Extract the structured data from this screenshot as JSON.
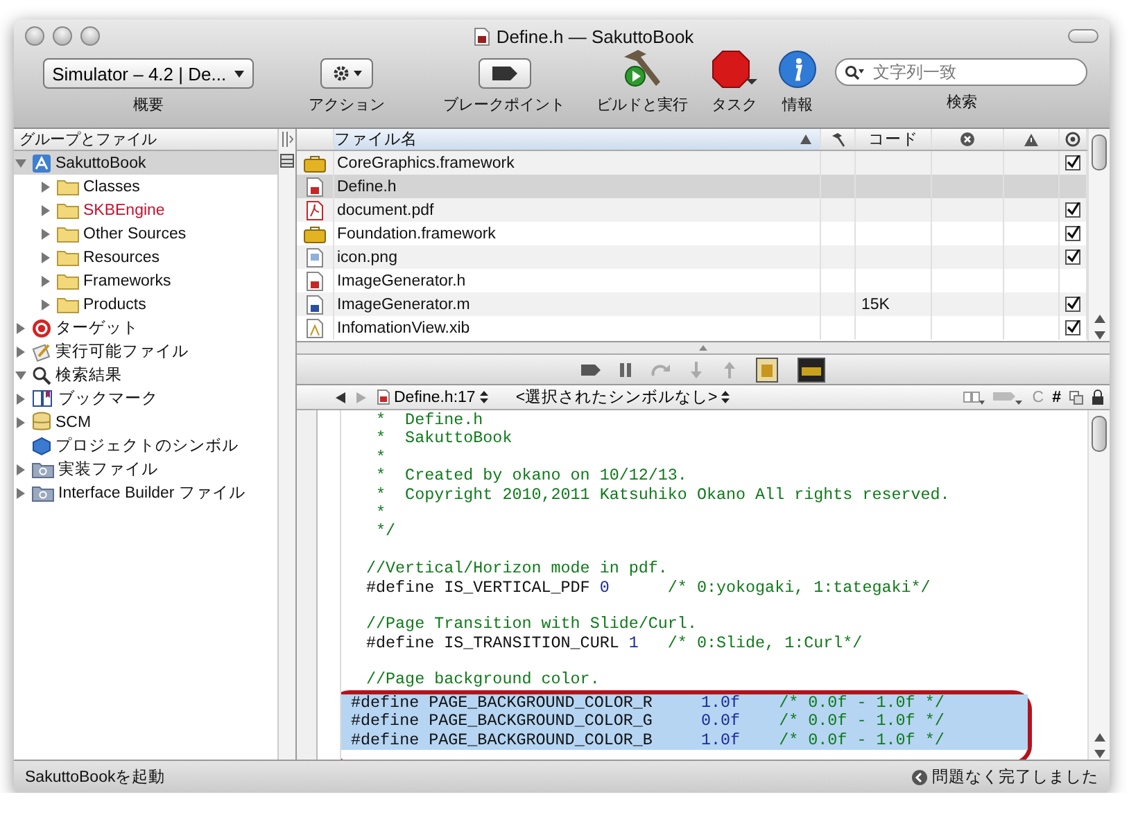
{
  "window": {
    "title": "Define.h — SakuttoBook"
  },
  "toolbar": {
    "scheme_popup": "Simulator – 4.2 | De...",
    "items": [
      {
        "kind": "scheme",
        "label": "概要"
      },
      {
        "kind": "action",
        "label": "アクション"
      },
      {
        "kind": "breakpoints",
        "label": "ブレークポイント"
      },
      {
        "kind": "build",
        "label": "ビルドと実行"
      },
      {
        "kind": "tasks",
        "label": "タスク"
      },
      {
        "kind": "info",
        "label": "情報"
      },
      {
        "kind": "search",
        "label": "検索"
      }
    ],
    "search": {
      "placeholder": "文字列一致"
    }
  },
  "sidebar": {
    "header": "グループとファイル",
    "items": [
      {
        "kind": "project",
        "label": "SakuttoBook",
        "expanded": true,
        "selected": true,
        "children": [
          {
            "kind": "folder",
            "label": "Classes",
            "expanded": false,
            "missing": false,
            "selected": false
          },
          {
            "kind": "folder",
            "label": "SKBEngine",
            "expanded": false,
            "missing": true,
            "selected": false
          },
          {
            "kind": "folder",
            "label": "Other Sources",
            "expanded": false,
            "missing": false,
            "selected": false
          },
          {
            "kind": "folder",
            "label": "Resources",
            "expanded": false,
            "missing": false,
            "selected": false
          },
          {
            "kind": "folder",
            "label": "Frameworks",
            "expanded": false,
            "missing": false,
            "selected": false
          },
          {
            "kind": "folder",
            "label": "Products",
            "expanded": false,
            "missing": false,
            "selected": false
          }
        ]
      },
      {
        "kind": "target",
        "label": "ターゲット",
        "expanded": false,
        "selected": false
      },
      {
        "kind": "executable",
        "label": "実行可能ファイル",
        "expanded": false,
        "selected": false
      },
      {
        "kind": "search",
        "label": "検索結果",
        "expanded": true,
        "selected": false
      },
      {
        "kind": "bookmark",
        "label": "ブックマーク",
        "expanded": false,
        "selected": false
      },
      {
        "kind": "scm",
        "label": "SCM",
        "expanded": false,
        "selected": false
      },
      {
        "kind": "symbols",
        "label": "プロジェクトのシンボル",
        "selected": false
      },
      {
        "kind": "smartgroup",
        "label": "実装ファイル",
        "expanded": false,
        "selected": false
      },
      {
        "kind": "smartgroup",
        "label": "Interface Builder ファイル",
        "expanded": false,
        "selected": false
      }
    ]
  },
  "file_list": {
    "columns": [
      {
        "kind": "text",
        "label": "ファイル名"
      },
      {
        "kind": "build"
      },
      {
        "kind": "text",
        "label": "コード"
      },
      {
        "kind": "errors"
      },
      {
        "kind": "warnings"
      },
      {
        "kind": "target"
      }
    ],
    "rows": [
      {
        "kind": "framework",
        "name": "CoreGraphics.framework",
        "code": "",
        "checked": true,
        "selected": false
      },
      {
        "kind": "header",
        "name": "Define.h",
        "code": "",
        "checked": false,
        "selected": true
      },
      {
        "kind": "pdf",
        "name": "document.pdf",
        "code": "",
        "checked": true,
        "selected": false
      },
      {
        "kind": "framework",
        "name": "Foundation.framework",
        "code": "",
        "checked": true,
        "selected": false
      },
      {
        "kind": "image",
        "name": "icon.png",
        "code": "",
        "checked": true,
        "selected": false
      },
      {
        "kind": "header",
        "name": "ImageGenerator.h",
        "code": "",
        "checked": false,
        "selected": false
      },
      {
        "kind": "source",
        "name": "ImageGenerator.m",
        "code": "15K",
        "checked": true,
        "selected": false
      },
      {
        "kind": "xib",
        "name": "InfomationView.xib",
        "code": "",
        "checked": true,
        "selected": false
      }
    ]
  },
  "editor": {
    "file_popup": "Define.h:17",
    "symbol_popup": "<選択されたシンボルなし>",
    "class_menu": "C",
    "include_menu": "#",
    "lines": [
      {
        "kind": "comment",
        "text": " *  Define.h",
        "selected": false
      },
      {
        "kind": "comment",
        "text": " *  SakuttoBook",
        "selected": false
      },
      {
        "kind": "comment",
        "text": " *",
        "selected": false
      },
      {
        "kind": "comment",
        "text": " *  Created by okano on 10/12/13.",
        "selected": false
      },
      {
        "kind": "comment",
        "text": " *  Copyright 2010,2011 Katsuhiko Okano All rights reserved.",
        "selected": false
      },
      {
        "kind": "comment",
        "text": " *",
        "selected": false
      },
      {
        "kind": "comment",
        "text": " */",
        "selected": false
      },
      {
        "kind": "blank",
        "selected": false
      },
      {
        "kind": "comment",
        "text": "//Vertical/Horizon mode in pdf.",
        "selected": false
      },
      {
        "kind": "define",
        "directive": "#define IS_VERTICAL_PDF",
        "value": "0",
        "comment": "/* 0:yokogaki, 1:tategaki*/",
        "selected": false
      },
      {
        "kind": "blank",
        "selected": false
      },
      {
        "kind": "comment",
        "text": "//Page Transition with Slide/Curl.",
        "selected": false
      },
      {
        "kind": "define",
        "directive": "#define IS_TRANSITION_CURL",
        "value": "1",
        "comment": "/* 0:Slide, 1:Curl*/",
        "selected": false
      },
      {
        "kind": "blank",
        "selected": false
      },
      {
        "kind": "comment",
        "text": "//Page background color.",
        "selected": false
      },
      {
        "kind": "define",
        "directive": "#define PAGE_BACKGROUND_COLOR_R",
        "value": "1.0f",
        "comment": "/* 0.0f - 1.0f */",
        "selected": true
      },
      {
        "kind": "define",
        "directive": "#define PAGE_BACKGROUND_COLOR_G",
        "value": "0.0f",
        "comment": "/* 0.0f - 1.0f */",
        "selected": true
      },
      {
        "kind": "define",
        "directive": "#define PAGE_BACKGROUND_COLOR_B",
        "value": "1.0f",
        "comment": "/* 0.0f - 1.0f */",
        "selected": true
      }
    ]
  },
  "status_bar": {
    "left": "SakuttoBookを起動",
    "right": "問題なく完了しました"
  }
}
